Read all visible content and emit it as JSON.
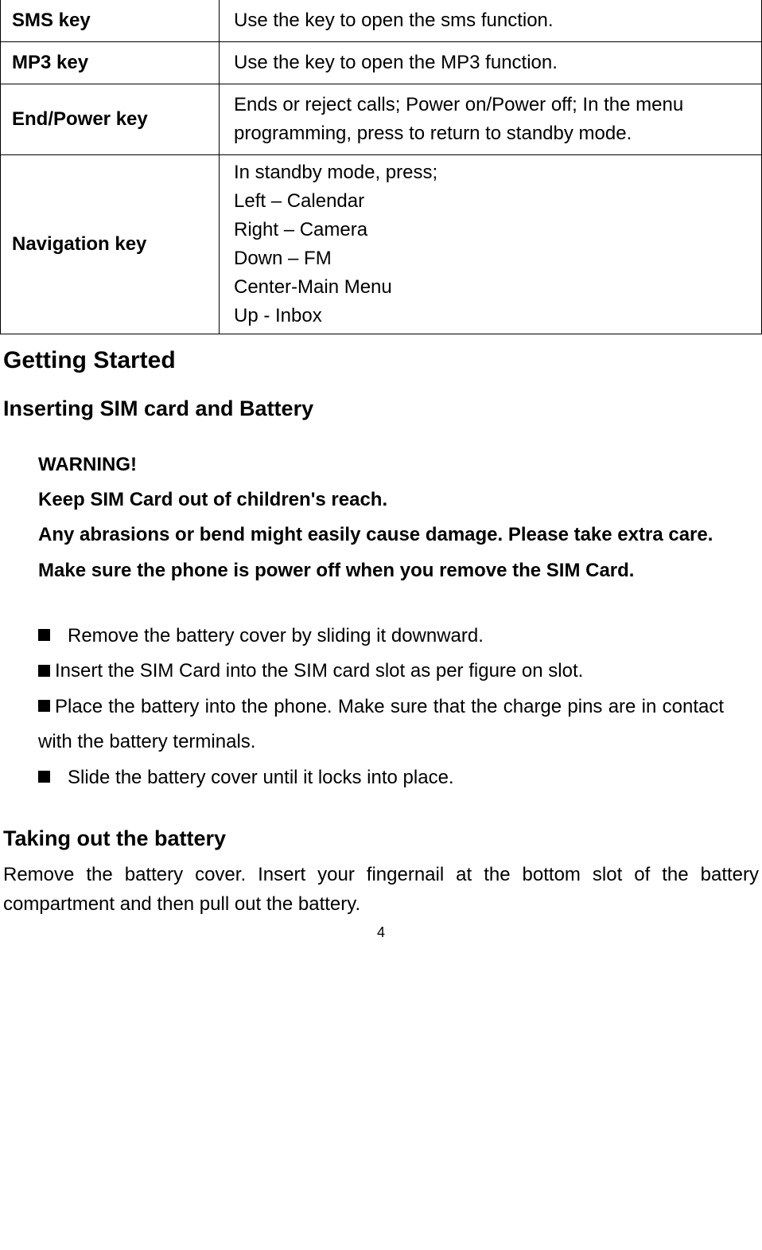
{
  "table": {
    "rows": [
      {
        "key": "SMS key",
        "desc": "Use the key to open the sms function."
      },
      {
        "key": "MP3 key",
        "desc": "Use the key to open the MP3 function."
      },
      {
        "key": "End/Power key",
        "desc": "Ends or reject calls; Power on/Power off; In the menu programming, press to return to standby mode."
      },
      {
        "key": "Navigation key",
        "desc_lines": [
          "In standby mode, press;",
          "Left – Calendar",
          "Right – Camera",
          "Down – FM",
          "Center-Main Menu",
          "Up - Inbox"
        ]
      }
    ]
  },
  "headings": {
    "h1": "Getting Started",
    "h2": "Inserting SIM card and Battery",
    "h3": "Taking out the battery"
  },
  "warning": {
    "title": "WARNING!",
    "line1": "Keep SIM Card out of children's reach.",
    "line2": "Any abrasions or bend might easily cause damage. Please take extra care.",
    "line3": "Make sure the phone is power off when you remove the SIM Card."
  },
  "bullets": [
    "Remove the battery cover by sliding it downward.",
    "Insert the SIM Card into the SIM card slot as per figure on slot.",
    "Place the battery into the phone. Make sure that the charge pins are in contact with the battery terminals.",
    "Slide the battery cover until it locks into place."
  ],
  "body_text": "Remove the battery cover. Insert your fingernail at the bottom slot of the battery compartment and then pull out the battery.",
  "page_number": "4"
}
